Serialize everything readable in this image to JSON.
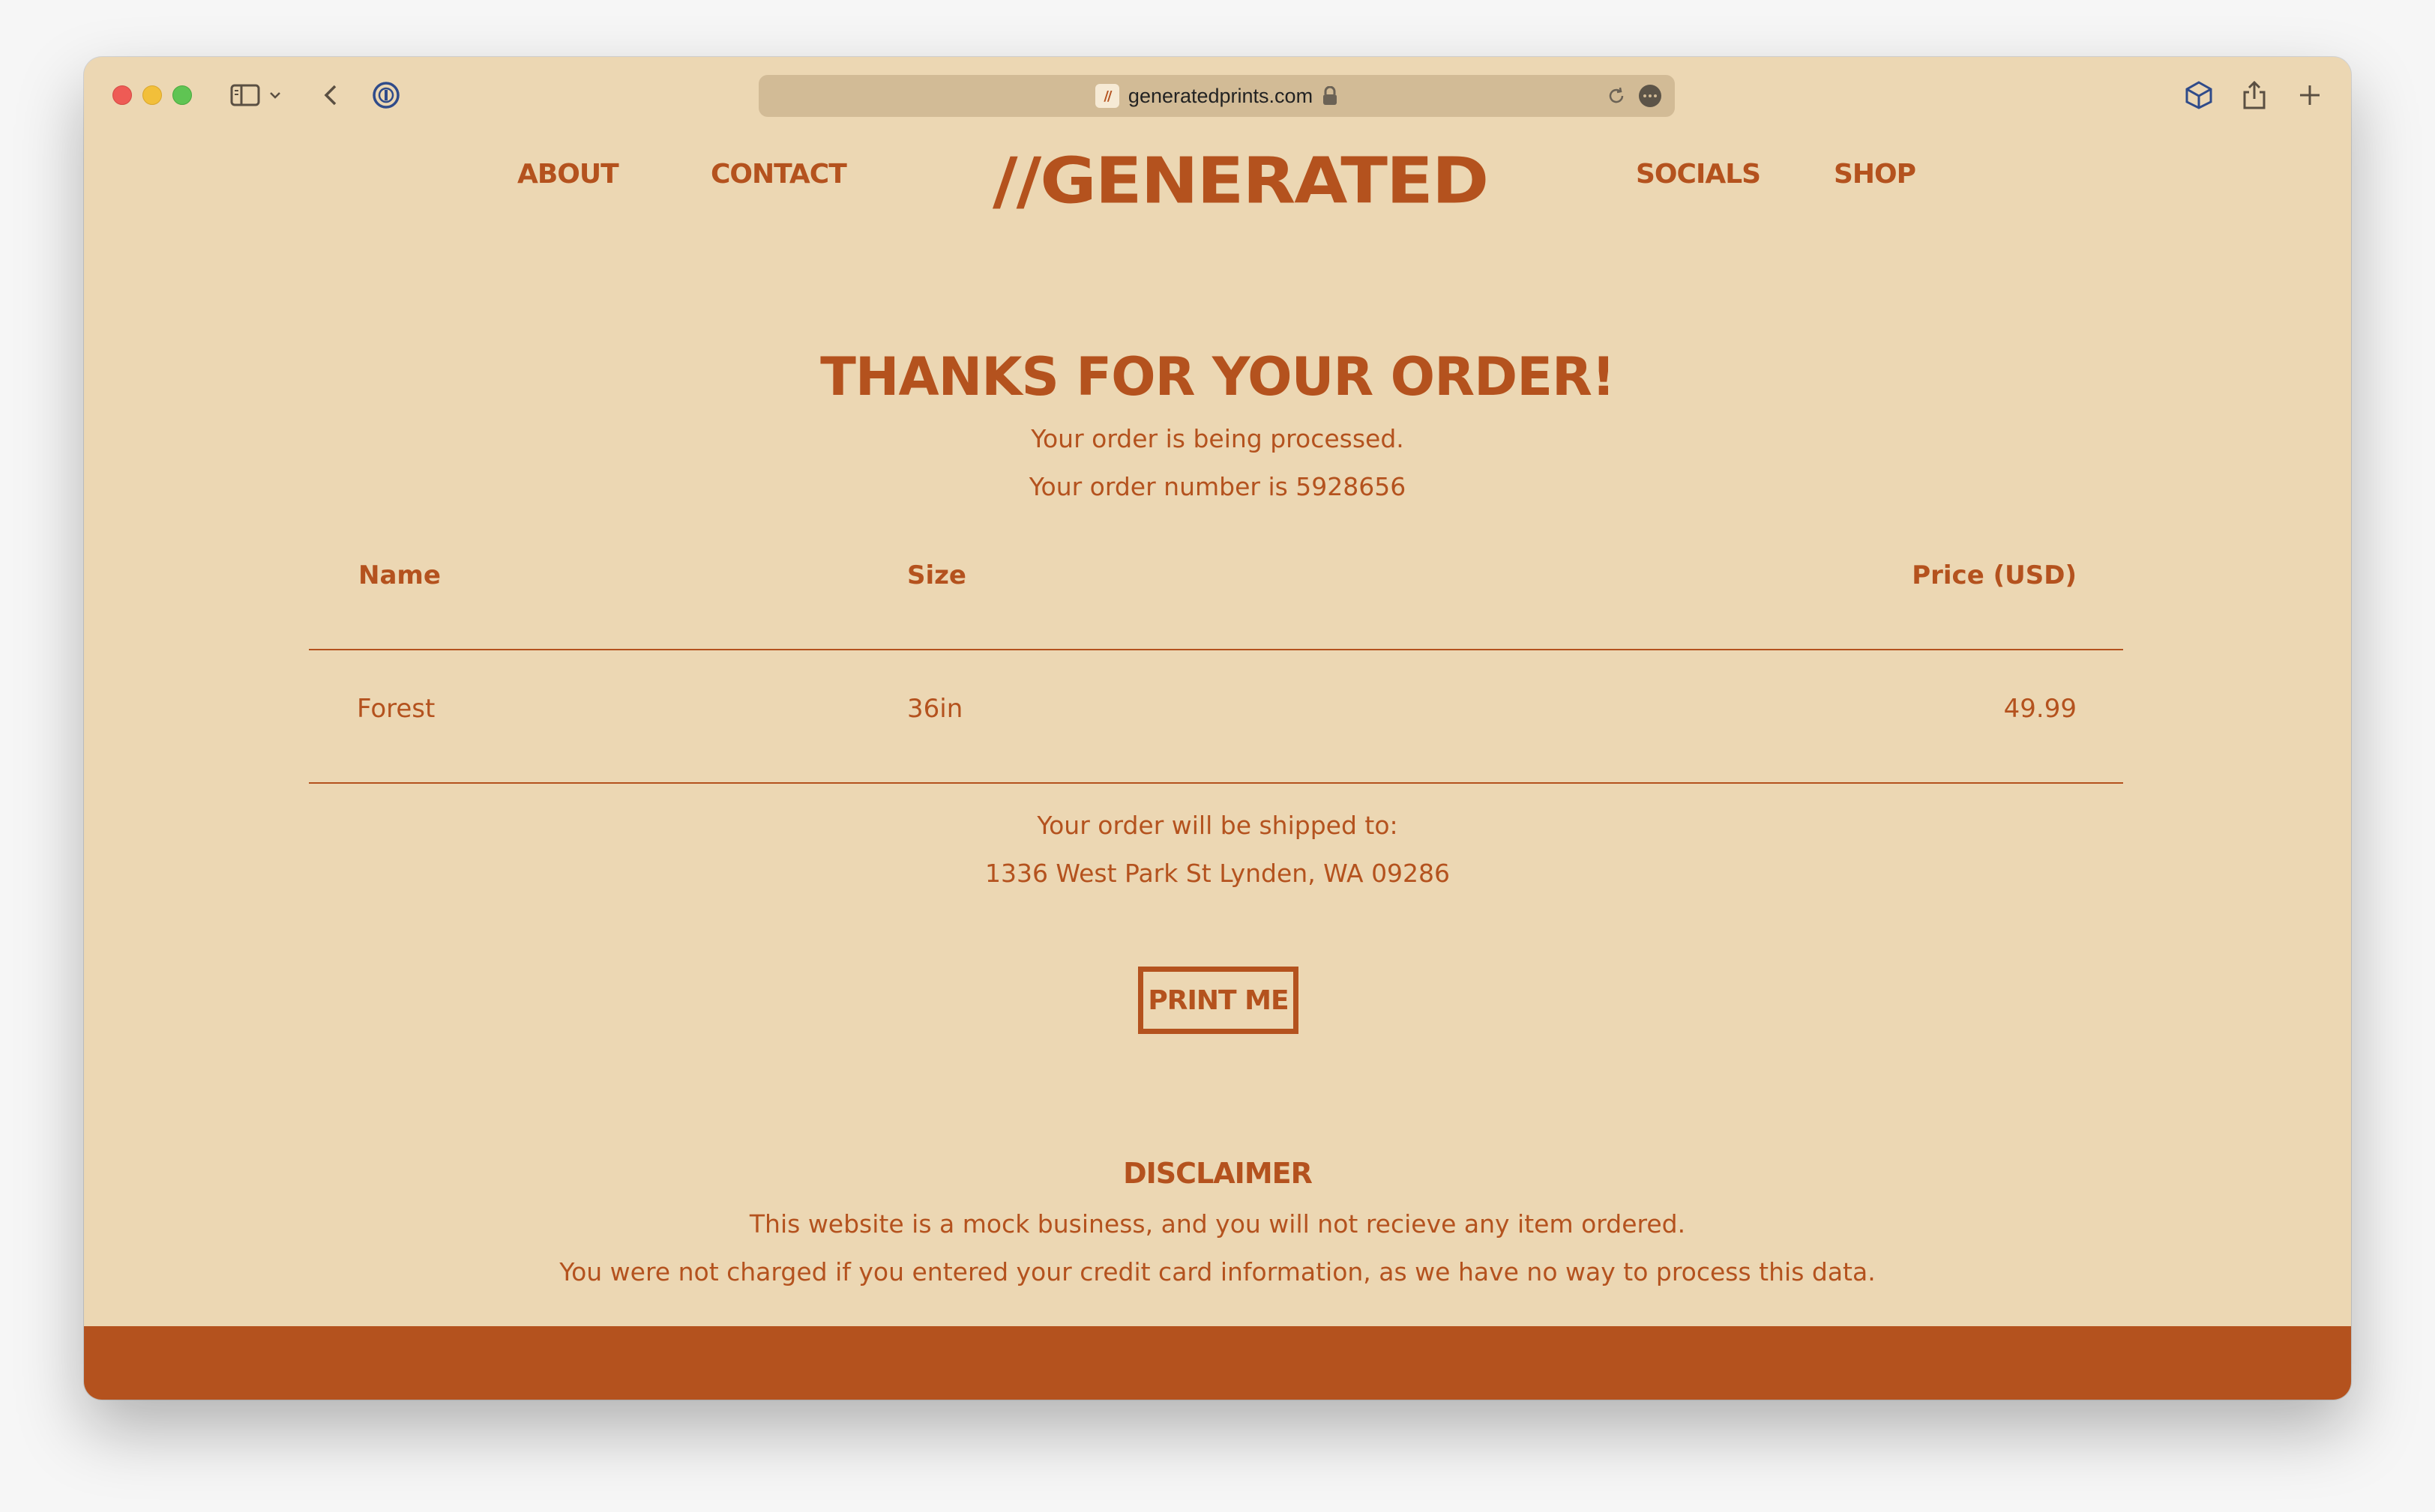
{
  "browser": {
    "url": "generatedprints.com",
    "favicon_text": "//"
  },
  "nav": {
    "about": "ABOUT",
    "contact": "CONTACT",
    "logo": "//GENERATED",
    "socials": "SOCIALS",
    "shop": "SHOP"
  },
  "order": {
    "heading": "THANKS FOR YOUR ORDER!",
    "status": "Your order is being processed.",
    "number_line": "Your order number is 5928656"
  },
  "table": {
    "headers": [
      "Name",
      "Size",
      "Price (USD)"
    ],
    "rows": [
      [
        "Forest",
        "36in",
        "49.99"
      ]
    ]
  },
  "shipping": {
    "label": "Your order will be shipped to:",
    "address": "1336 West Park St Lynden, WA 09286"
  },
  "print_button": "PRINT ME",
  "disclaimer": {
    "title": "DISCLAIMER",
    "line1": "This website is a mock business, and you will not recieve any item ordered.",
    "line2": "You were not charged if you entered your credit card information, as we have no way to process this data."
  },
  "colors": {
    "background": "#ecd7b3",
    "accent": "#b4521e"
  }
}
